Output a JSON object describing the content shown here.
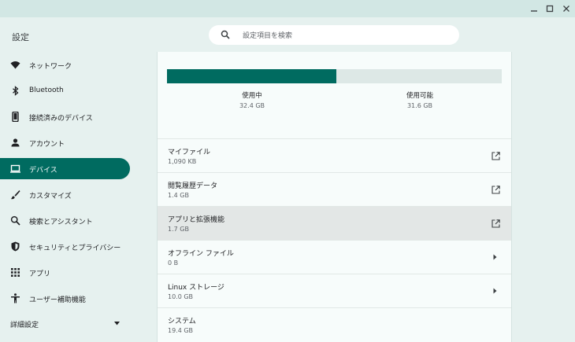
{
  "window": {
    "minimize_icon": "minimize-icon",
    "maximize_icon": "maximize-icon",
    "close_icon": "close-icon"
  },
  "header": {
    "title": "設定",
    "search_placeholder": "設定項目を検索"
  },
  "sidebar": {
    "items": [
      {
        "label": "ネットワーク",
        "icon": "wifi-icon"
      },
      {
        "label": "Bluetooth",
        "icon": "bluetooth-icon"
      },
      {
        "label": "接続済みのデバイス",
        "icon": "phone-icon"
      },
      {
        "label": "アカウント",
        "icon": "person-icon"
      },
      {
        "label": "デバイス",
        "icon": "laptop-icon",
        "active": true
      },
      {
        "label": "カスタマイズ",
        "icon": "brush-icon"
      },
      {
        "label": "検索とアシスタント",
        "icon": "search-icon"
      },
      {
        "label": "セキュリティとプライバシー",
        "icon": "shield-icon"
      },
      {
        "label": "アプリ",
        "icon": "apps-grid-icon"
      },
      {
        "label": "ユーザー補助機能",
        "icon": "accessibility-icon"
      }
    ],
    "advanced_label": "詳細設定"
  },
  "storage": {
    "used_fraction": 0.506,
    "used_label": "使用中",
    "used_value": "32.4 GB",
    "available_label": "使用可能",
    "available_value": "31.6 GB",
    "accent_color": "#006b60",
    "rows": [
      {
        "label": "マイファイル",
        "size": "1,090 KB",
        "icon": "external-link-icon"
      },
      {
        "label": "閲覧履歴データ",
        "size": "1.4 GB",
        "icon": "external-link-icon"
      },
      {
        "label": "アプリと拡張機能",
        "size": "1.7 GB",
        "icon": "external-link-icon",
        "highlighted": true
      },
      {
        "label": "オフライン ファイル",
        "size": "0 B",
        "icon": "chevron-right-icon"
      },
      {
        "label": "Linux ストレージ",
        "size": "10.0 GB",
        "icon": "chevron-right-icon"
      },
      {
        "label": "システム",
        "size": "19.4 GB"
      }
    ]
  }
}
